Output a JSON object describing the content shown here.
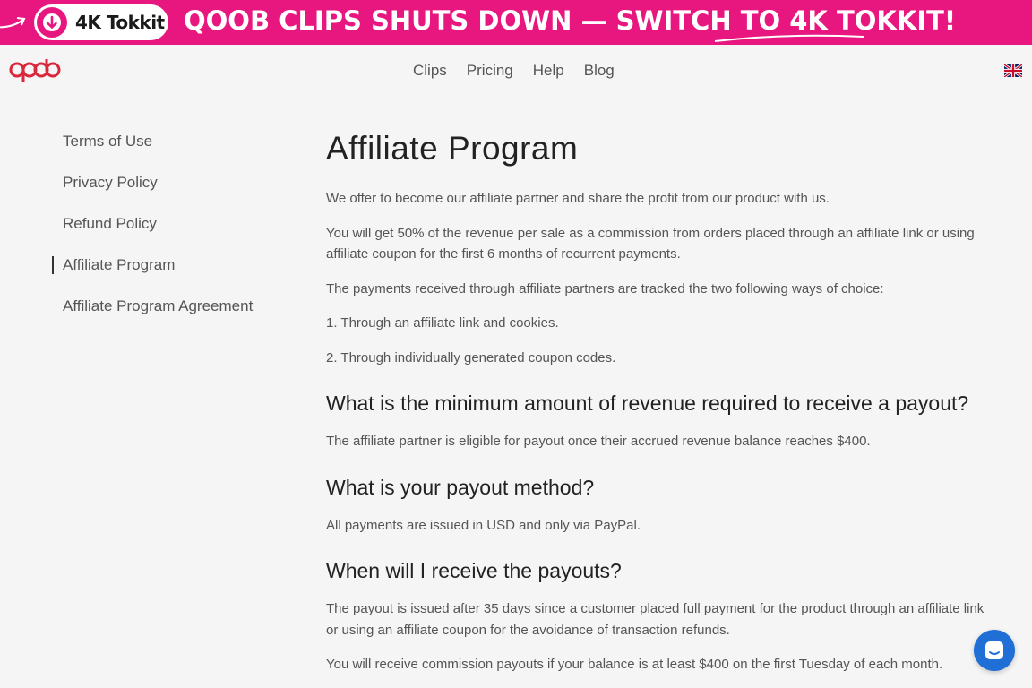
{
  "banner": {
    "pill_text": "4K Tokkit",
    "message": "QOOB CLIPS SHUTS DOWN — SWITCH TO 4K TOKKIT!",
    "bg_color": "#e8177f"
  },
  "header": {
    "nav": [
      "Clips",
      "Pricing",
      "Help",
      "Blog"
    ],
    "language_icon": "uk-flag-icon"
  },
  "sidebar": {
    "items": [
      {
        "label": "Terms of Use",
        "active": false
      },
      {
        "label": "Privacy Policy",
        "active": false
      },
      {
        "label": "Refund Policy",
        "active": false
      },
      {
        "label": "Affiliate Program",
        "active": true
      },
      {
        "label": "Affiliate Program Agreement",
        "active": false
      }
    ]
  },
  "main": {
    "title": "Affiliate Program",
    "intro": [
      "We offer to become our affiliate partner and share the profit from our product with us.",
      "You will get 50% of the revenue per sale as a commission from orders placed through an affiliate link or using affiliate coupon for the first 6 months of recurrent payments.",
      "The payments received through affiliate partners are tracked the two following ways of choice:",
      "1. Through an affiliate link and cookies.",
      "2. Through individually generated coupon codes."
    ],
    "sections": [
      {
        "heading": "What is the minimum amount of revenue required to receive a payout?",
        "paragraphs": [
          "The affiliate partner is eligible for payout once their accrued revenue balance reaches $400."
        ]
      },
      {
        "heading": "What is your payout method?",
        "paragraphs": [
          "All payments are issued in USD and only via PayPal."
        ]
      },
      {
        "heading": "When will I receive the payouts?",
        "paragraphs": [
          "The payout is issued after 35 days since a customer placed full payment for the product through an affiliate link or using an affiliate coupon for the avoidance of transaction refunds.",
          "You will receive commission payouts if your balance is at least $400 on the first Tuesday of each month."
        ]
      }
    ]
  },
  "chat": {
    "icon": "chat-icon",
    "color": "#1f6fd6"
  }
}
